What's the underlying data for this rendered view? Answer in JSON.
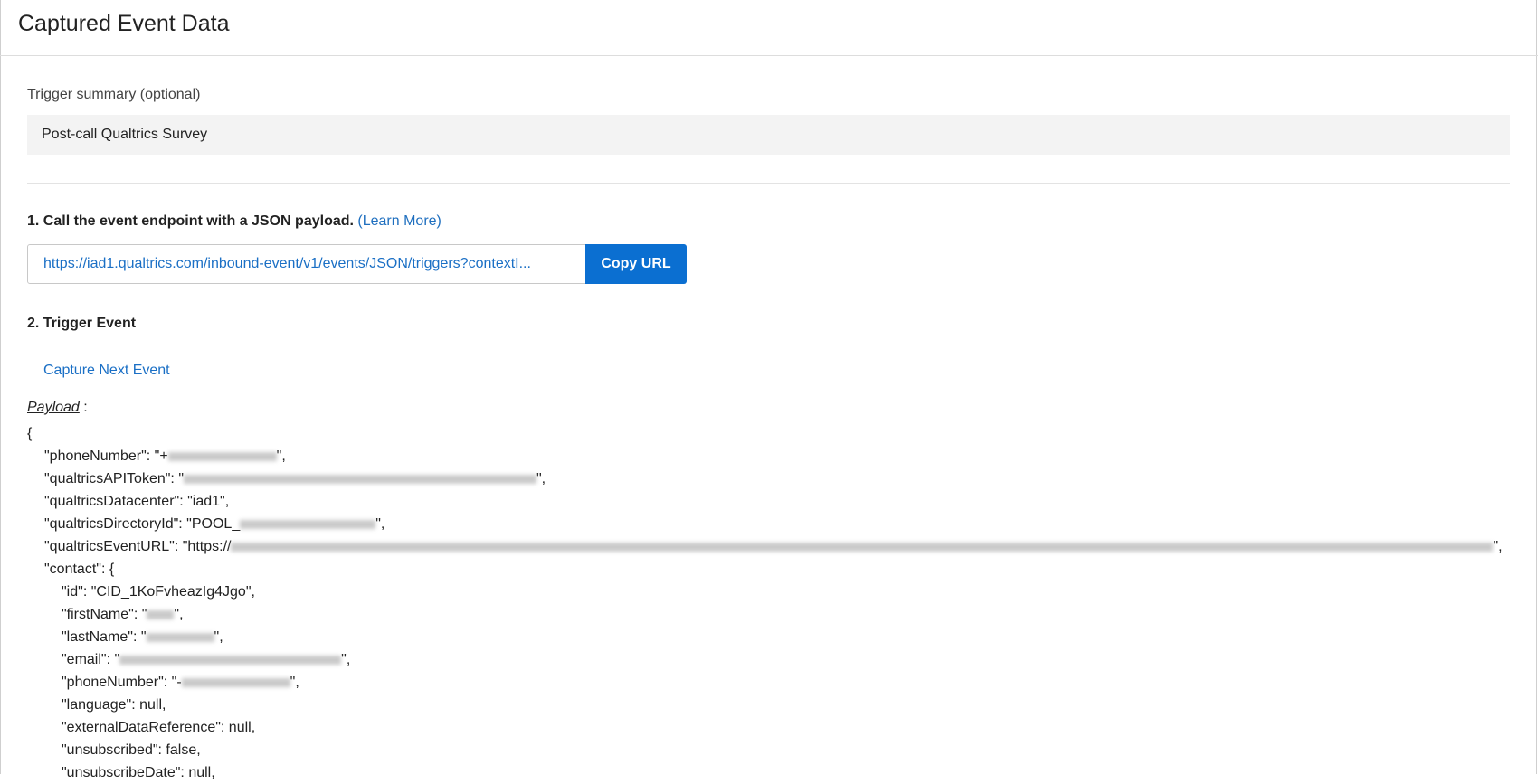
{
  "header": {
    "title": "Captured Event Data"
  },
  "summary": {
    "label": "Trigger summary (optional)",
    "value": "Post-call Qualtrics Survey"
  },
  "step1": {
    "heading": "1. Call the event endpoint with a JSON payload.",
    "learn_more": "(Learn More)",
    "url": "https://iad1.qualtrics.com/inbound-event/v1/events/JSON/triggers?contextI...",
    "copy_label": "Copy URL"
  },
  "step2": {
    "heading": "2. Trigger Event",
    "capture_label": "Capture Next Event",
    "payload_label": "Payload",
    "payload_colon": " :"
  },
  "payload_lines": [
    {
      "indent": 0,
      "text": "{"
    },
    {
      "indent": 1,
      "text": "\"phoneNumber\": \"+",
      "blur": 120,
      "after": "\","
    },
    {
      "indent": 1,
      "text": "\"qualtricsAPIToken\": \"",
      "blur": 390,
      "after": "\","
    },
    {
      "indent": 1,
      "text": "\"qualtricsDatacenter\": \"iad1\","
    },
    {
      "indent": 1,
      "text": "\"qualtricsDirectoryId\": \"POOL_",
      "blur": 150,
      "after": "\","
    },
    {
      "indent": 1,
      "text": "\"qualtricsEventURL\": \"https://",
      "blur": 1395,
      "after": "\","
    },
    {
      "indent": 1,
      "text": "\"contact\": {"
    },
    {
      "indent": 2,
      "text": "\"id\": \"CID_1KoFvheazIg4Jgo\","
    },
    {
      "indent": 2,
      "text": "\"firstName\": \"",
      "blur": 30,
      "after": "\","
    },
    {
      "indent": 2,
      "text": "\"lastName\": \"",
      "blur": 75,
      "after": "\","
    },
    {
      "indent": 2,
      "text": "\"email\": \"",
      "blur": 245,
      "after": "\","
    },
    {
      "indent": 2,
      "text": "\"phoneNumber\": \"-",
      "blur": 120,
      "after": "\","
    },
    {
      "indent": 2,
      "text": "\"language\": null,"
    },
    {
      "indent": 2,
      "text": "\"externalDataReference\": null,"
    },
    {
      "indent": 2,
      "text": "\"unsubscribed\": false,"
    },
    {
      "indent": 2,
      "text": "\"unsubscribeDate\": null,"
    }
  ]
}
